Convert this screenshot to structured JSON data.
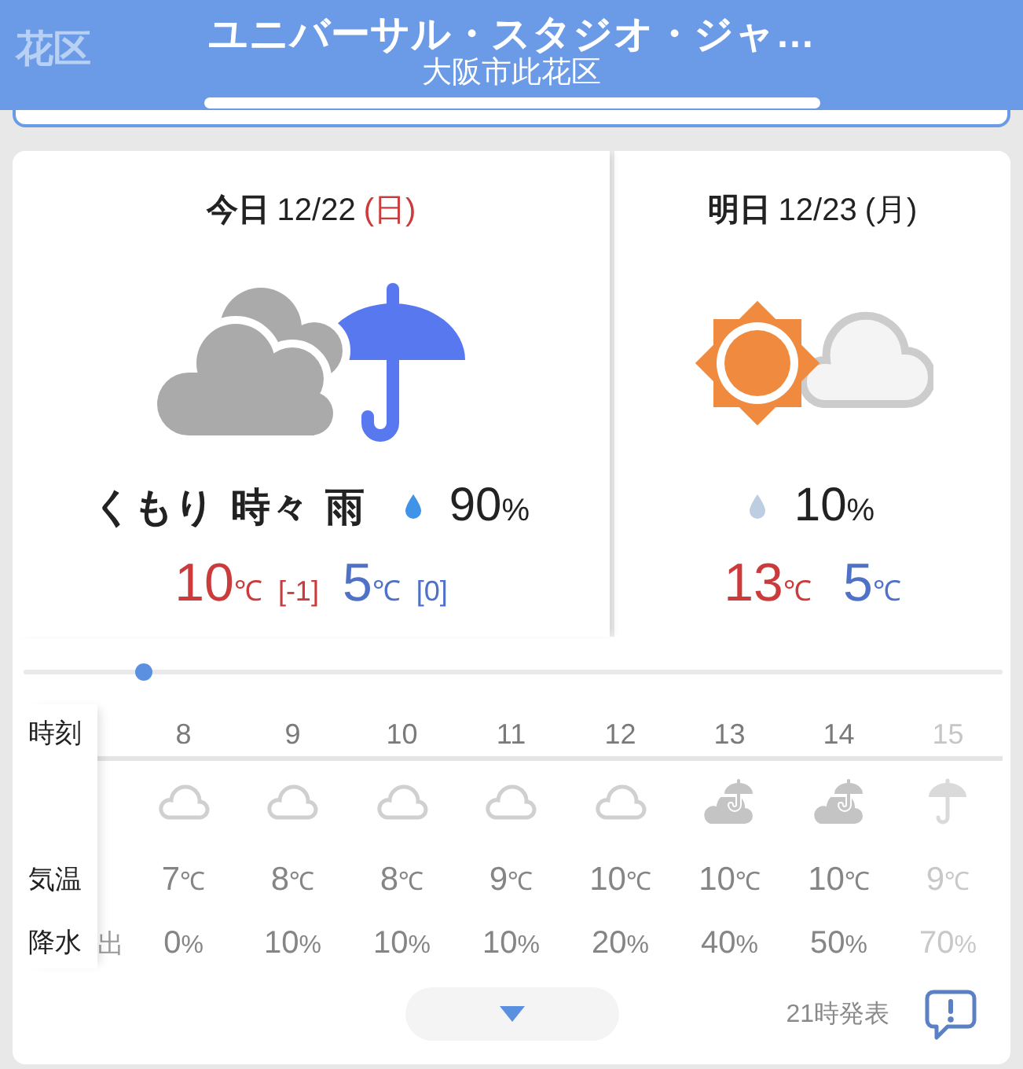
{
  "header": {
    "ghost_text": "花区",
    "title": "ユニバーサル・スタジオ・ジャ…",
    "subtitle": "大阪市此花区"
  },
  "days": [
    {
      "label": "今日",
      "date": "12/22",
      "weekday": "(日)",
      "holiday": true,
      "kind": "cloudy_rain",
      "condition": "くもり 時々 雨",
      "rain": {
        "value": "90",
        "unit": "%",
        "color": "#3f93e8"
      },
      "high": {
        "value": "10",
        "unit": "℃",
        "diff": "[-1]"
      },
      "low": {
        "value": "5",
        "unit": "℃",
        "diff": "[0]"
      }
    },
    {
      "label": "明日",
      "date": "12/23",
      "weekday": "(月)",
      "holiday": false,
      "kind": "sunny_cloudy",
      "rain": {
        "value": "10",
        "unit": "%",
        "color": "#bdcde2"
      },
      "high": {
        "value": "13",
        "unit": "℃"
      },
      "low": {
        "value": "5",
        "unit": "℃"
      }
    }
  ],
  "hourly": {
    "row_labels": [
      "時刻",
      "気温",
      "降水"
    ],
    "cut_text": "出",
    "hours": [
      {
        "time": "8",
        "kind": "cloudy",
        "temp": "7",
        "temp_unit": "℃",
        "rain": "0",
        "rain_unit": "%"
      },
      {
        "time": "9",
        "kind": "cloudy",
        "temp": "8",
        "temp_unit": "℃",
        "rain": "10",
        "rain_unit": "%"
      },
      {
        "time": "10",
        "kind": "cloudy",
        "temp": "8",
        "temp_unit": "℃",
        "rain": "10",
        "rain_unit": "%"
      },
      {
        "time": "11",
        "kind": "cloudy",
        "temp": "9",
        "temp_unit": "℃",
        "rain": "10",
        "rain_unit": "%"
      },
      {
        "time": "12",
        "kind": "cloudy",
        "temp": "10",
        "temp_unit": "℃",
        "rain": "20",
        "rain_unit": "%"
      },
      {
        "time": "13",
        "kind": "cloudy_rain",
        "temp": "10",
        "temp_unit": "℃",
        "rain": "40",
        "rain_unit": "%"
      },
      {
        "time": "14",
        "kind": "cloudy_rain",
        "temp": "10",
        "temp_unit": "℃",
        "rain": "50",
        "rain_unit": "%"
      },
      {
        "time": "15",
        "kind": "rain",
        "temp": "9",
        "temp_unit": "℃",
        "rain": "70",
        "rain_unit": "%"
      }
    ]
  },
  "footer": {
    "issued": "21時発表"
  }
}
